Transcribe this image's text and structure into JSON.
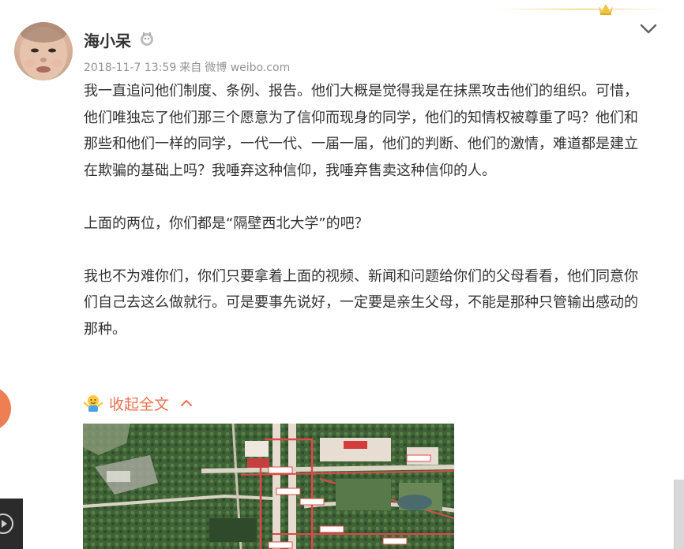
{
  "post": {
    "username": "海小呆",
    "timestamp": "2018-11-7 13:59",
    "source_prefix": "来自",
    "source": "微博 weibo.com",
    "paragraphs": [
      "我一直追问他们制度、条例、报告。他们大概是觉得我是在抹黑攻击他们的组织。可惜，他们唯独忘了他们那三个愿意为了信仰而现身的同学，他们的知情权被尊重了吗？他们和那些和他们一样的同学，一代一代、一届一届，他们的判断、他们的激情，难道都是建立在欺骗的基础上吗？我唾弃这种信仰，我唾弃售卖这种信仰的人。",
      "上面的两位，你们都是“隔壁西北大学”的吧？",
      "我也不为难你们，你们只要拿着上面的视频、新闻和问题给你们的父母看看，他们同意你们自己去这么做就行。可是要事先说好，一定要是亲生父母，不能是那种只管输出感动的那种。"
    ],
    "collapse_label": "收起全文"
  },
  "colors": {
    "accent": "#eb7350",
    "text": "#333333",
    "meta": "#939393",
    "crown": "#f0c446"
  },
  "icons": {
    "badge": "user-badge-icon",
    "more": "chevron-down-icon",
    "collapse": "chevron-up-icon",
    "emoji": "shrug-emoji-icon",
    "crown": "crown-icon"
  }
}
